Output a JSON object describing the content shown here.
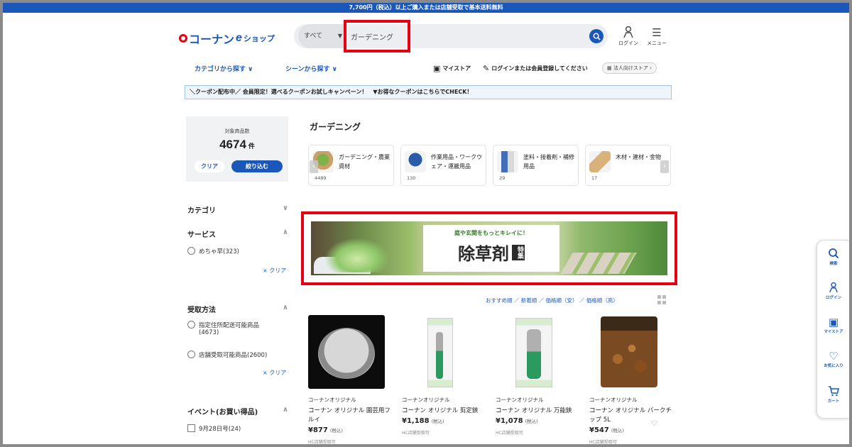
{
  "topbar": {
    "text": "7,700円（税込）以上ご購入または店舗受取で基本送料無料"
  },
  "header": {
    "logo_text": "コーナン",
    "logo_e": "e",
    "logo_shop": "ショップ",
    "search": {
      "category": "すべて",
      "value": "ガーデニング"
    },
    "login_label": "ログイン",
    "menu_label": "メニュー"
  },
  "nav": {
    "category_browse": "カテゴリから探す",
    "scene_browse": "シーンから探す",
    "my_store": "マイストア",
    "login_register": "ログインまたは会員登録してください",
    "business_store": "法人向けストア"
  },
  "coupon_banner": "＼クーポン配布中／ 会員限定！選べるクーポンお試しキャンペーン！　▼お得なクーポンはこちらでCHECK！",
  "filter": {
    "count_label": "対象商品数",
    "count_value": "4674",
    "count_unit": "件",
    "clear_label": "クリア",
    "apply_label": "絞り込む",
    "sections": {
      "category": "カテゴリ",
      "service": "サービス",
      "service_opt1": "めちゃ早(323)",
      "clear_link": "× クリア",
      "pickup": "受取方法",
      "pickup_opt1": "指定住所配送可能商品",
      "pickup_opt1_count": "(4673)",
      "pickup_opt2": "店舗受取可能商品(2600)",
      "event": "イベント(お買い得品)",
      "event_opt1": "9月28日号(24)"
    }
  },
  "main": {
    "title": "ガーデニング",
    "categories": [
      {
        "label": "ガーデニング・農業資材",
        "count": "4489"
      },
      {
        "label": "作業用品・ワークウェア・運搬用品",
        "count": "130"
      },
      {
        "label": "塗料・接着剤・補修用品",
        "count": "29"
      },
      {
        "label": "木材・建材・金物",
        "count": "17"
      }
    ],
    "banner": {
      "sub": "庭や玄関をもっとキレイに！",
      "main": "除草剤",
      "tag": "特集"
    },
    "sort_options": "おすすめ順 ／ 新着順 ／ 価格順（安） ／ 価格順（高）",
    "products": [
      {
        "brand": "コーナンオリジナル",
        "name": "コーナン オリジナル 園芸用フルイ",
        "price": "¥877",
        "tax": "(税込)",
        "note": "HC店舗受取可"
      },
      {
        "brand": "コーナンオリジナル",
        "name": "コーナン オリジナル 剪定鋏",
        "price": "¥1,188",
        "tax": "(税込)",
        "note": "HC店舗受取可"
      },
      {
        "brand": "コーナンオリジナル",
        "name": "コーナン オリジナル 万能鋏",
        "price": "¥1,078",
        "tax": "(税込)",
        "note": "HC店舗受取可"
      },
      {
        "brand": "コーナンオリジナル",
        "name": "コーナン オリジナル バークチップ 5L",
        "price": "¥547",
        "tax": "(税込)",
        "note": "HC店舗受取可"
      }
    ]
  },
  "side_float": {
    "search": "検索",
    "login": "ログイン",
    "mystore": "マイストア",
    "favorite": "お気に入り",
    "cart": "カート"
  },
  "colors": {
    "brand_blue": "#1b57b8",
    "highlight_red": "#e60012"
  }
}
